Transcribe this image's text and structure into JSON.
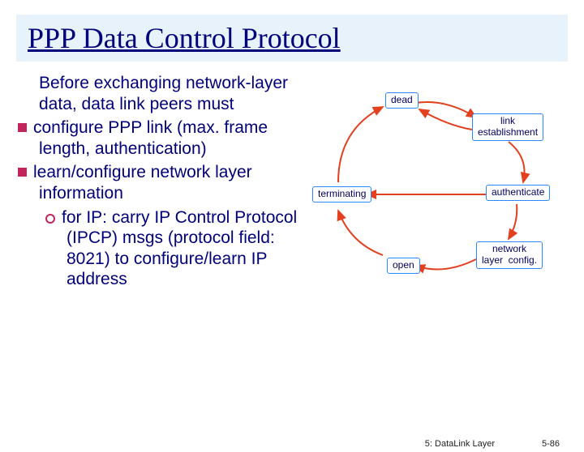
{
  "title": "PPP Data Control Protocol",
  "intro": "Before exchanging network-layer data, data link peers must",
  "bullets": [
    "configure PPP link (max. frame length, authentication)",
    "learn/configure network layer information"
  ],
  "subbullets": [
    "for IP: carry IP Control Protocol (IPCP) msgs (protocol field: 8021) to configure/learn IP address"
  ],
  "diagram": {
    "nodes": {
      "dead": "dead",
      "link_est": "link\nestablishment",
      "auth": "authenticate",
      "netcfg": "network\nlayer  config.",
      "open": "open",
      "term": "terminating"
    }
  },
  "footer": {
    "section": "5: DataLink Layer",
    "page": "5-86"
  }
}
